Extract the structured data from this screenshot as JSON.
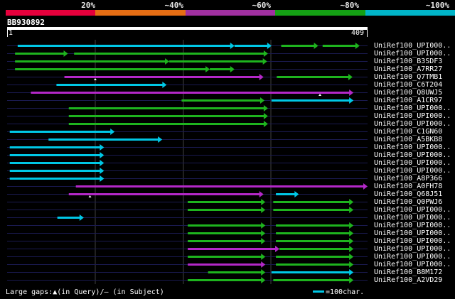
{
  "scale": {
    "segments": [
      {
        "color": "#e6003c"
      },
      {
        "color": "#e66e14"
      },
      {
        "color": "#a030a0"
      },
      {
        "color": "#14a014"
      },
      {
        "color": "#00b4c8"
      }
    ],
    "labels": [
      "20%",
      "~40%",
      "~60%",
      "~80%",
      "~100%"
    ]
  },
  "query": {
    "name": "BB930892",
    "start": "1",
    "end": "409",
    "length": 409
  },
  "colors": {
    "cyan": "#00c8e6",
    "green": "#1eb41e",
    "purple": "#b428c8",
    "white": "#ffffff",
    "navy": "#1a1a50",
    "grid": "#404040"
  },
  "legend": {
    "gaps_text": "Large gaps:▲(in Query)/– (in Subject)",
    "key_label": "=100char."
  },
  "hits": [
    {
      "name": "UniRef100_UPI000..",
      "segs": [
        [
          12,
          258,
          "cyan"
        ],
        [
          258,
          300,
          "cyan"
        ],
        [
          311,
          353,
          "green"
        ],
        [
          358,
          400,
          "green"
        ]
      ]
    },
    {
      "name": "UniRef100_UPI000..",
      "segs": [
        [
          9,
          69,
          "green"
        ],
        [
          76,
          296,
          "green"
        ]
      ]
    },
    {
      "name": "UniRef100_B3SDF3",
      "segs": [
        [
          9,
          184,
          "green"
        ],
        [
          184,
          295,
          "green"
        ]
      ]
    },
    {
      "name": "UniRef100_A7RR27",
      "segs": [
        [
          9,
          230,
          "green"
        ],
        [
          230,
          258,
          "green"
        ]
      ]
    },
    {
      "name": "UniRef100_Q7TMB1",
      "segs": [
        [
          65,
          291,
          "purple"
        ],
        [
          306,
          392,
          "green"
        ]
      ],
      "gapQ": 100
    },
    {
      "name": "UniRef100_C6T204",
      "segs": [
        [
          56,
          181,
          "cyan"
        ]
      ]
    },
    {
      "name": "UniRef100_Q8UWJ5",
      "segs": [
        [
          27,
          393,
          "purple"
        ]
      ],
      "gapQ": 355
    },
    {
      "name": "UniRef100_A1CR97",
      "segs": [
        [
          198,
          292,
          "green"
        ],
        [
          300,
          393,
          "cyan"
        ]
      ]
    },
    {
      "name": "UniRef100_UPI000..",
      "segs": [
        [
          70,
          296,
          "green"
        ]
      ]
    },
    {
      "name": "UniRef100_UPI000..",
      "segs": [
        [
          70,
          296,
          "green"
        ]
      ]
    },
    {
      "name": "UniRef100_UPI000..",
      "segs": [
        [
          70,
          296,
          "green"
        ]
      ]
    },
    {
      "name": "UniRef100_C1GN60",
      "segs": [
        [
          3,
          122,
          "cyan"
        ]
      ]
    },
    {
      "name": "UniRef100_A5BKB8",
      "segs": [
        [
          47,
          176,
          "cyan"
        ]
      ]
    },
    {
      "name": "UniRef100_UPI000..",
      "segs": [
        [
          3,
          110,
          "cyan"
        ]
      ]
    },
    {
      "name": "UniRef100_UPI000..",
      "segs": [
        [
          3,
          110,
          "cyan"
        ]
      ]
    },
    {
      "name": "UniRef100_UPI000..",
      "segs": [
        [
          3,
          110,
          "cyan"
        ]
      ]
    },
    {
      "name": "UniRef100_UPI000..",
      "segs": [
        [
          3,
          110,
          "cyan"
        ]
      ]
    },
    {
      "name": "UniRef100_A8P366",
      "segs": [
        [
          3,
          110,
          "cyan"
        ]
      ]
    },
    {
      "name": "UniRef100_A0FH78",
      "segs": [
        [
          78,
          409,
          "purple"
        ]
      ]
    },
    {
      "name": "UniRef100_Q68J51",
      "segs": [
        [
          70,
          291,
          "purple"
        ],
        [
          305,
          331,
          "cyan"
        ]
      ],
      "gapQ": 94
    },
    {
      "name": "UniRef100_Q0PWJ6",
      "segs": [
        [
          205,
          293,
          "green"
        ],
        [
          302,
          393,
          "green"
        ]
      ]
    },
    {
      "name": "UniRef100_UPI000..",
      "segs": [
        [
          205,
          293,
          "green"
        ],
        [
          302,
          393,
          "green"
        ]
      ]
    },
    {
      "name": "UniRef100_UPI000..",
      "segs": [
        [
          57,
          87,
          "cyan"
        ]
      ]
    },
    {
      "name": "UniRef100_UPI000..",
      "segs": [
        [
          205,
          293,
          "green"
        ],
        [
          305,
          393,
          "green"
        ]
      ]
    },
    {
      "name": "UniRef100_UPI000..",
      "segs": [
        [
          205,
          293,
          "green"
        ],
        [
          305,
          393,
          "green"
        ]
      ]
    },
    {
      "name": "UniRef100_UPI000..",
      "segs": [
        [
          205,
          293,
          "green"
        ],
        [
          305,
          393,
          "green"
        ]
      ]
    },
    {
      "name": "UniRef100_UPI000..",
      "segs": [
        [
          205,
          309,
          "purple"
        ],
        [
          309,
          393,
          "green"
        ]
      ]
    },
    {
      "name": "UniRef100_UPI000..",
      "segs": [
        [
          205,
          293,
          "green"
        ],
        [
          305,
          393,
          "green"
        ]
      ]
    },
    {
      "name": "UniRef100_UPI000..",
      "segs": [
        [
          205,
          293,
          "purple"
        ],
        [
          305,
          393,
          "green"
        ]
      ]
    },
    {
      "name": "UniRef100_B8M172",
      "segs": [
        [
          228,
          293,
          "green"
        ],
        [
          300,
          393,
          "cyan"
        ]
      ]
    },
    {
      "name": "UniRef100_A2VD29",
      "segs": [
        [
          205,
          293,
          "green"
        ],
        [
          302,
          393,
          "green"
        ]
      ]
    }
  ]
}
